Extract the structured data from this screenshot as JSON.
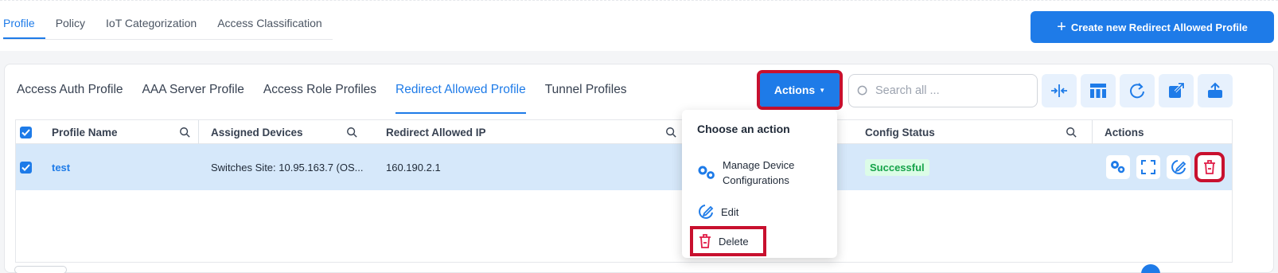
{
  "top_tabs": [
    {
      "label": "Profile",
      "active": true
    },
    {
      "label": "Policy",
      "active": false
    },
    {
      "label": "IoT Categorization",
      "active": false
    },
    {
      "label": "Access Classification",
      "active": false
    }
  ],
  "create_button": {
    "label": "Create new Redirect Allowed Profile",
    "icon": "plus-icon"
  },
  "sub_tabs": [
    {
      "label": "Access Auth Profile",
      "active": false
    },
    {
      "label": "AAA Server Profile",
      "active": false
    },
    {
      "label": "Access Role Profiles",
      "active": false
    },
    {
      "label": "Redirect Allowed Profile",
      "active": true
    },
    {
      "label": "Tunnel Profiles",
      "active": false
    }
  ],
  "actions_button": {
    "label": "Actions"
  },
  "search": {
    "placeholder": "Search all ..."
  },
  "toolbar_icons": [
    "collapse-columns-icon",
    "column-layout-icon",
    "refresh-icon",
    "export-icon",
    "upload-icon"
  ],
  "table": {
    "columns": [
      "Profile Name",
      "Assigned Devices",
      "Redirect Allowed IP",
      "Config Status",
      "Actions"
    ],
    "rows": [
      {
        "selected": true,
        "profile_name": "test",
        "assigned_devices": "Switches Site: 10.95.163.7 (OS...",
        "redirect_allowed_ip": "160.190.2.1",
        "config_status": "Successful",
        "row_actions": [
          "manage-config-icon",
          "expand-icon",
          "edit-icon",
          "delete-icon"
        ]
      }
    ]
  },
  "dropdown": {
    "title": "Choose an action",
    "items": [
      {
        "label": "Manage Device Configurations",
        "icon": "manage-config-icon"
      },
      {
        "label": "Edit",
        "icon": "edit-icon"
      },
      {
        "label": "Delete",
        "icon": "delete-icon"
      }
    ]
  },
  "colors": {
    "accent": "#1e7be8",
    "highlight": "#c8102e",
    "success": "#16a34a",
    "row_selected": "#d6e8fa"
  }
}
